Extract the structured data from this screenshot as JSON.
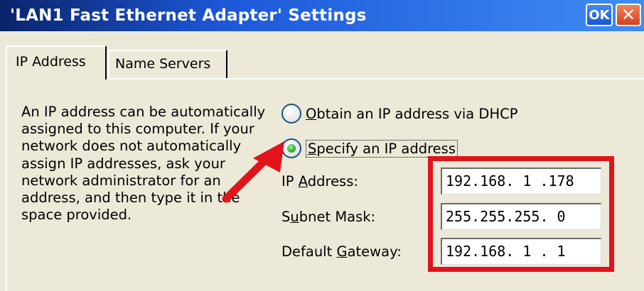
{
  "window": {
    "title": "'LAN1 Fast Ethernet Adapter' Settings",
    "ok_label": "OK",
    "close_glyph": "✕"
  },
  "tabs": [
    {
      "label": "IP Address"
    },
    {
      "label": "Name Servers"
    }
  ],
  "description": "An IP address can be automatically assigned to this computer. If your network does not automatically assign IP addresses, ask your network administrator for an address, and then type it in the space provided.",
  "options": {
    "dhcp": {
      "pre": "",
      "key": "O",
      "post": "btain an IP address via DHCP",
      "selected": false
    },
    "specify": {
      "pre": "",
      "key": "S",
      "post": "pecify an IP address",
      "selected": true
    }
  },
  "fields": {
    "ip": {
      "pre": "IP ",
      "key": "A",
      "post": "ddress:",
      "value": "192.168. 1 .178"
    },
    "mask": {
      "pre": "S",
      "key": "u",
      "post": "bnet Mask:",
      "value": "255.255.255. 0"
    },
    "gateway": {
      "pre": "Default ",
      "key": "G",
      "post": "ateway:",
      "value": "192.168. 1 . 1"
    }
  },
  "annotation_colors": {
    "arrow": "#e0141a",
    "highlight_box": "#e0141a"
  }
}
